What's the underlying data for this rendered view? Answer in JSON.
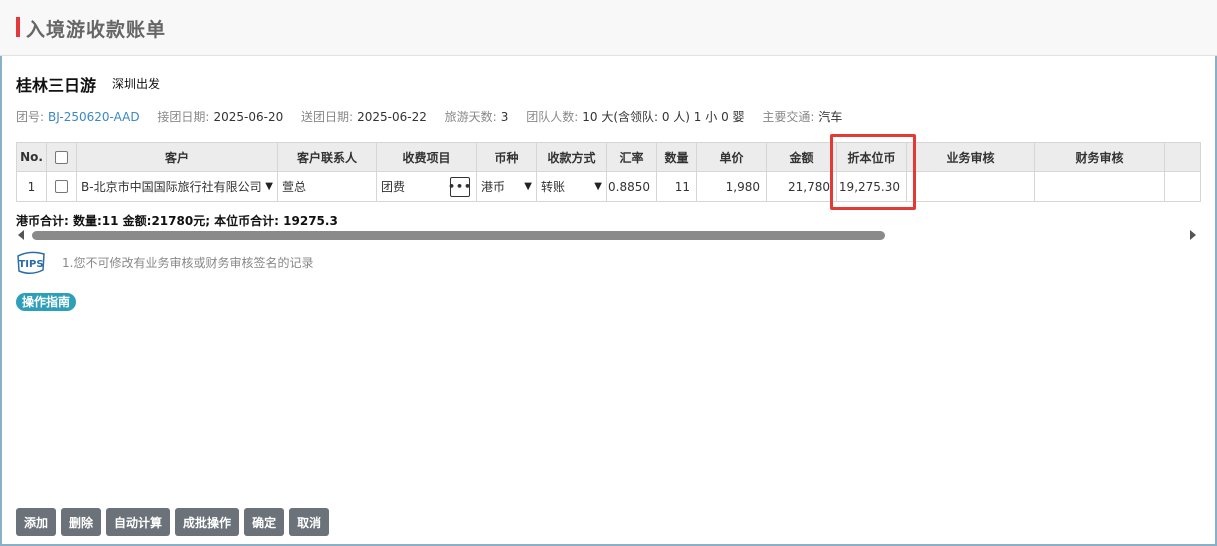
{
  "page": {
    "title": "入境游收款账单"
  },
  "tour": {
    "name": "桂林三日游",
    "departure": "深圳出发",
    "meta": {
      "group_no_label": "团号:",
      "group_no": "BJ-250620-AAD",
      "pickup_label": "接团日期:",
      "pickup": "2025-06-20",
      "dropoff_label": "送团日期:",
      "dropoff": "2025-06-22",
      "days_label": "旅游天数:",
      "days": "3",
      "people_label": "团队人数:",
      "people": "10 大(含领队: 0 人) 1 小 0 婴",
      "transport_label": "主要交通:",
      "transport": "汽车"
    }
  },
  "table": {
    "headers": {
      "no": "No.",
      "customer": "客户",
      "contact": "客户联系人",
      "fee_item": "收费项目",
      "currency": "币种",
      "pay_method": "收款方式",
      "rate": "汇率",
      "qty": "数量",
      "unit_price": "单价",
      "amount": "金额",
      "local_amount": "折本位币",
      "biz_audit": "业务审核",
      "fin_audit": "财务审核"
    },
    "rows": [
      {
        "no": "1",
        "customer": "B-北京市中国国际旅行社有限公司",
        "contact": "萱总",
        "fee_item": "团费",
        "currency": "港币",
        "pay_method": "转账",
        "rate": "0.8850",
        "qty": "11",
        "unit_price": "1,980",
        "amount": "21,780",
        "local_amount": "19,275.30",
        "biz_audit": "",
        "fin_audit": ""
      }
    ]
  },
  "summary": "港币合计: 数量:11 金额:21780元; 本位币合计: 19275.3",
  "tips": {
    "icon_text": "TIPS",
    "text": "1.您不可修改有业务审核或财务审核签名的记录"
  },
  "guide_button": "操作指南",
  "actions": {
    "add": "添加",
    "delete": "删除",
    "auto_calc": "自动计算",
    "batch": "成批操作",
    "confirm": "确定",
    "cancel": "取消"
  },
  "colors": {
    "accent": "#e4393c",
    "link": "#3a88c5",
    "guide": "#2e9fba",
    "button": "#6b7279",
    "highlight": "#e53935"
  }
}
